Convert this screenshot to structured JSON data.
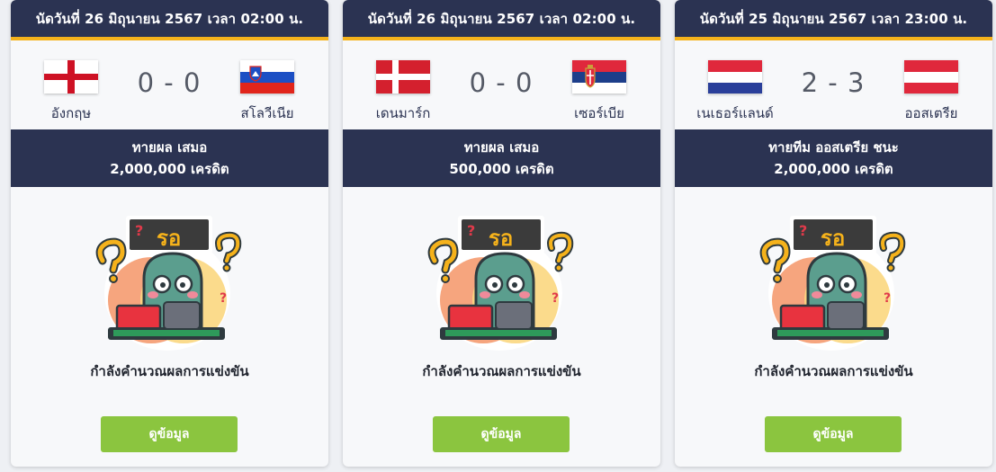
{
  "cards": [
    {
      "header": "นัดวันที่ 26 มิถุนายน 2567 เวลา 02:00 น.",
      "home": {
        "name": "อังกฤษ",
        "flag": "england-flag-icon"
      },
      "away": {
        "name": "สโลวีเนีย",
        "flag": "slovenia-flag-icon"
      },
      "score": "0 - 0",
      "prediction_line1_prefix": "ทายผล ",
      "prediction_pick": "เสมอ",
      "prediction_line1_suffix": "",
      "prediction_credits": "2,000,000 เครดิต",
      "illustration_sign": "รอ",
      "status": "กำลังคำนวณผลการแข่งขัน",
      "button": "ดูข้อมูล"
    },
    {
      "header": "นัดวันที่ 26 มิถุนายน 2567 เวลา 02:00 น.",
      "home": {
        "name": "เดนมาร์ก",
        "flag": "denmark-flag-icon"
      },
      "away": {
        "name": "เซอร์เบีย",
        "flag": "serbia-flag-icon"
      },
      "score": "0 - 0",
      "prediction_line1_prefix": "ทายผล ",
      "prediction_pick": "เสมอ",
      "prediction_line1_suffix": "",
      "prediction_credits": "500,000 เครดิต",
      "illustration_sign": "รอ",
      "status": "กำลังคำนวณผลการแข่งขัน",
      "button": "ดูข้อมูล"
    },
    {
      "header": "นัดวันที่ 25 มิถุนายน 2567 เวลา 23:00 น.",
      "home": {
        "name": "เนเธอร์แลนด์",
        "flag": "netherlands-flag-icon"
      },
      "away": {
        "name": "ออสเตรีย",
        "flag": "austria-flag-icon"
      },
      "score": "2 - 3",
      "prediction_line1_prefix": "ทายทีม ",
      "prediction_pick": "ออสเตรีย",
      "prediction_line1_suffix": " ชนะ",
      "prediction_credits": "2,000,000 เครดิต",
      "illustration_sign": "รอ",
      "status": "กำลังคำนวณผลการแข่งขัน",
      "button": "ดูข้อมูล"
    }
  ],
  "colors": {
    "header_bg": "#2b3352",
    "header_accent": "#f5b21b",
    "button_bg": "#8bc53f",
    "card_bg": "#f7f8fa"
  }
}
